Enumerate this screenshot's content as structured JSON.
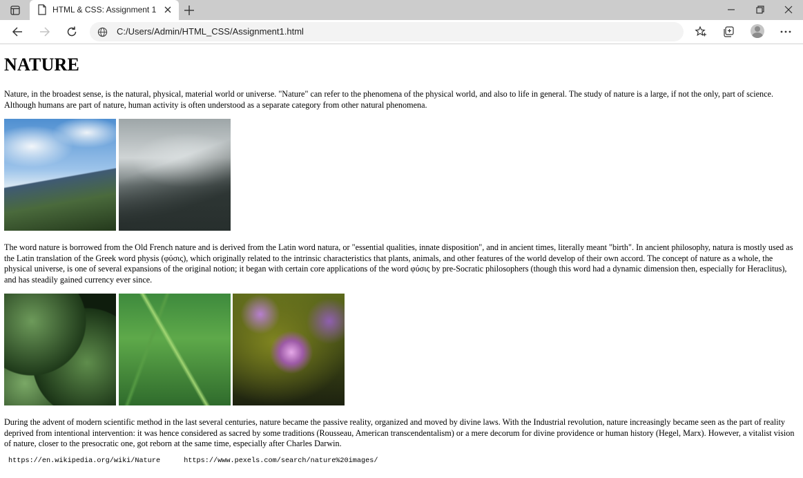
{
  "browser": {
    "tab_title": "HTML & CSS: Assignment 1",
    "address": "C:/Users/Admin/HTML_CSS/Assignment1.html"
  },
  "page": {
    "heading": "NATURE",
    "paragraphs": [
      "Nature, in the broadest sense, is the natural, physical, material world or universe. \"Nature\" can refer to the phenomena of the physical world, and also to life in general. The study of nature is a large, if not the only, part of science. Although humans are part of nature, human activity is often understood as a separate category from other natural phenomena.",
      "The word nature is borrowed from the Old French nature and is derived from the Latin word natura, or \"essential qualities, innate disposition\", and in ancient times, literally meant \"birth\". In ancient philosophy, natura is mostly used as the Latin translation of the Greek word physis (φύσις), which originally related to the intrinsic characteristics that plants, animals, and other features of the world develop of their own accord. The concept of nature as a whole, the physical universe, is one of several expansions of the original notion; it began with certain core applications of the word φύσις by pre-Socratic philosophers (though this word had a dynamic dimension then, especially for Heraclitus), and has steadily gained currency ever since.",
      "During the advent of modern scientific method in the last several centuries, nature became the passive reality, organized and moved by divine laws. With the Industrial revolution, nature increasingly became seen as the part of reality deprived from intentional intervention: it was hence considered as sacred by some traditions (Rousseau, American transcendentalism) or a mere decorum for divine providence or human history (Hegel, Marx). However, a vitalist vision of nature, closer to the presocratic one, got reborn at the same time, especially after Charles Darwin."
    ],
    "links": [
      "https://en.wikipedia.org/wiki/Nature",
      "https://www.pexels.com/search/nature%20images/"
    ]
  }
}
